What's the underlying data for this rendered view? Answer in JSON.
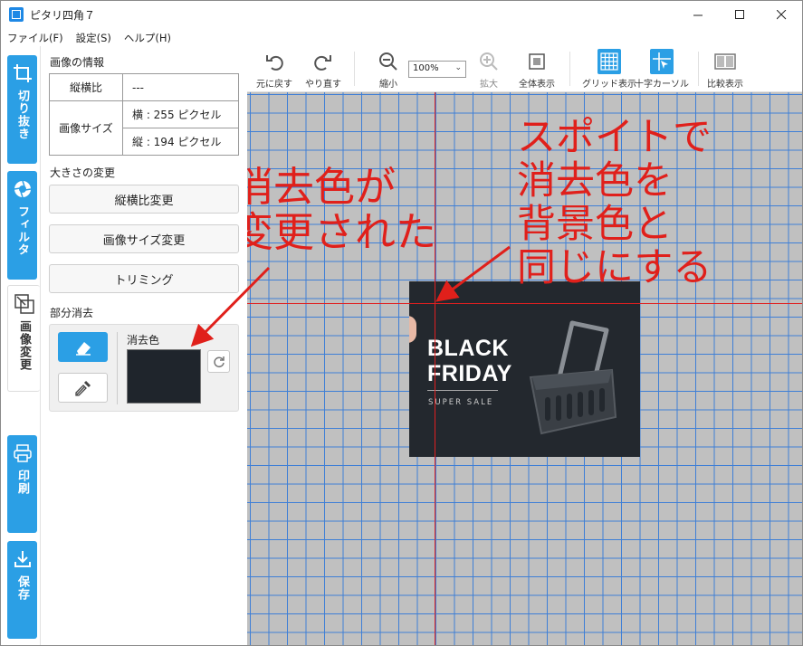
{
  "window": {
    "title": "ピタリ四角７"
  },
  "menu": [
    "ファイル(F)",
    "設定(S)",
    "ヘルプ(H)"
  ],
  "nav": {
    "crop": "切り抜き",
    "filter": "フィルタ",
    "image_change": "画像変更",
    "print": "印刷",
    "save": "保存"
  },
  "panel": {
    "info_title": "画像の情報",
    "aspect_label": "縦横比",
    "aspect_value": "---",
    "size_label": "画像サイズ",
    "width_value": "横 : 255 ピクセル",
    "height_value": "縦 : 194 ピクセル",
    "resize_title": "大きさの変更",
    "btn_aspect": "縦横比変更",
    "btn_size": "画像サイズ変更",
    "btn_trim": "トリミング",
    "erase_title": "部分消去",
    "erase_color_label": "消去色",
    "erase_color": "#1f252c"
  },
  "toolbar": {
    "undo": "元に戻す",
    "redo": "やり直す",
    "zoom_out": "縮小",
    "zoom_value": "100%",
    "zoom_in": "拡大",
    "fit": "全体表示",
    "grid": "グリッド表示",
    "cursor": "十字カーソル",
    "compare": "比較表示"
  },
  "image": {
    "line1": "BLACK",
    "line2": "FRIDAY",
    "line3": "SUPER SALE"
  },
  "annotations": {
    "left": "消去色が\n変更された",
    "right": "スポイトで\n消去色を\n背景色と\n同じにする"
  },
  "colors": {
    "accent": "#2b9fe5",
    "annotation": "#e0201b",
    "grid": "#3f7fd6",
    "canvas": "#c0c0c0"
  }
}
